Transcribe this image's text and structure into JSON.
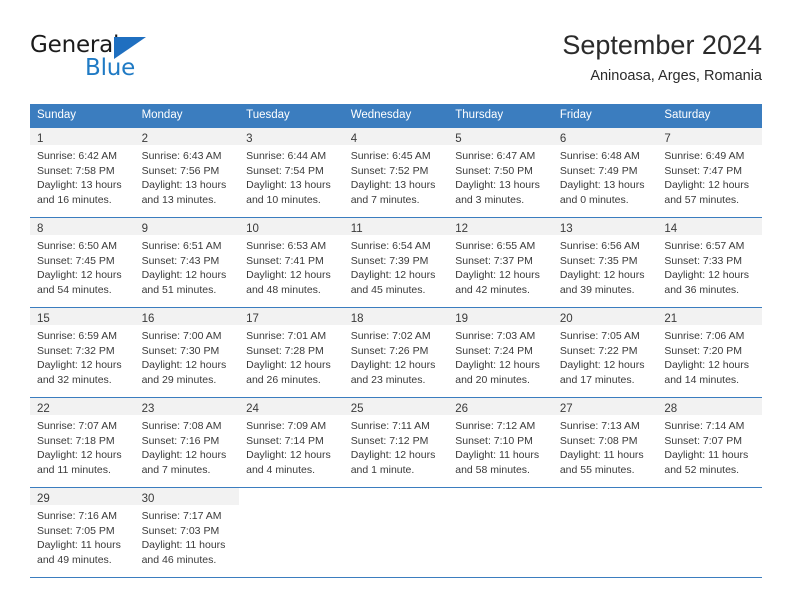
{
  "brand": {
    "name_top": "General",
    "name_bottom": "Blue",
    "accent_color": "#1f7ac4",
    "triangle_color": "#1f6fc0"
  },
  "header": {
    "title": "September 2024",
    "location": "Aninoasa, Arges, Romania"
  },
  "calendar": {
    "header_bg": "#3b7dbf",
    "daynum_band_bg": "#f2f2f2",
    "weekdays": [
      "Sunday",
      "Monday",
      "Tuesday",
      "Wednesday",
      "Thursday",
      "Friday",
      "Saturday"
    ],
    "weeks": [
      [
        {
          "day": "1",
          "sunrise": "Sunrise: 6:42 AM",
          "sunset": "Sunset: 7:58 PM",
          "daylight": "Daylight: 13 hours and 16 minutes."
        },
        {
          "day": "2",
          "sunrise": "Sunrise: 6:43 AM",
          "sunset": "Sunset: 7:56 PM",
          "daylight": "Daylight: 13 hours and 13 minutes."
        },
        {
          "day": "3",
          "sunrise": "Sunrise: 6:44 AM",
          "sunset": "Sunset: 7:54 PM",
          "daylight": "Daylight: 13 hours and 10 minutes."
        },
        {
          "day": "4",
          "sunrise": "Sunrise: 6:45 AM",
          "sunset": "Sunset: 7:52 PM",
          "daylight": "Daylight: 13 hours and 7 minutes."
        },
        {
          "day": "5",
          "sunrise": "Sunrise: 6:47 AM",
          "sunset": "Sunset: 7:50 PM",
          "daylight": "Daylight: 13 hours and 3 minutes."
        },
        {
          "day": "6",
          "sunrise": "Sunrise: 6:48 AM",
          "sunset": "Sunset: 7:49 PM",
          "daylight": "Daylight: 13 hours and 0 minutes."
        },
        {
          "day": "7",
          "sunrise": "Sunrise: 6:49 AM",
          "sunset": "Sunset: 7:47 PM",
          "daylight": "Daylight: 12 hours and 57 minutes."
        }
      ],
      [
        {
          "day": "8",
          "sunrise": "Sunrise: 6:50 AM",
          "sunset": "Sunset: 7:45 PM",
          "daylight": "Daylight: 12 hours and 54 minutes."
        },
        {
          "day": "9",
          "sunrise": "Sunrise: 6:51 AM",
          "sunset": "Sunset: 7:43 PM",
          "daylight": "Daylight: 12 hours and 51 minutes."
        },
        {
          "day": "10",
          "sunrise": "Sunrise: 6:53 AM",
          "sunset": "Sunset: 7:41 PM",
          "daylight": "Daylight: 12 hours and 48 minutes."
        },
        {
          "day": "11",
          "sunrise": "Sunrise: 6:54 AM",
          "sunset": "Sunset: 7:39 PM",
          "daylight": "Daylight: 12 hours and 45 minutes."
        },
        {
          "day": "12",
          "sunrise": "Sunrise: 6:55 AM",
          "sunset": "Sunset: 7:37 PM",
          "daylight": "Daylight: 12 hours and 42 minutes."
        },
        {
          "day": "13",
          "sunrise": "Sunrise: 6:56 AM",
          "sunset": "Sunset: 7:35 PM",
          "daylight": "Daylight: 12 hours and 39 minutes."
        },
        {
          "day": "14",
          "sunrise": "Sunrise: 6:57 AM",
          "sunset": "Sunset: 7:33 PM",
          "daylight": "Daylight: 12 hours and 36 minutes."
        }
      ],
      [
        {
          "day": "15",
          "sunrise": "Sunrise: 6:59 AM",
          "sunset": "Sunset: 7:32 PM",
          "daylight": "Daylight: 12 hours and 32 minutes."
        },
        {
          "day": "16",
          "sunrise": "Sunrise: 7:00 AM",
          "sunset": "Sunset: 7:30 PM",
          "daylight": "Daylight: 12 hours and 29 minutes."
        },
        {
          "day": "17",
          "sunrise": "Sunrise: 7:01 AM",
          "sunset": "Sunset: 7:28 PM",
          "daylight": "Daylight: 12 hours and 26 minutes."
        },
        {
          "day": "18",
          "sunrise": "Sunrise: 7:02 AM",
          "sunset": "Sunset: 7:26 PM",
          "daylight": "Daylight: 12 hours and 23 minutes."
        },
        {
          "day": "19",
          "sunrise": "Sunrise: 7:03 AM",
          "sunset": "Sunset: 7:24 PM",
          "daylight": "Daylight: 12 hours and 20 minutes."
        },
        {
          "day": "20",
          "sunrise": "Sunrise: 7:05 AM",
          "sunset": "Sunset: 7:22 PM",
          "daylight": "Daylight: 12 hours and 17 minutes."
        },
        {
          "day": "21",
          "sunrise": "Sunrise: 7:06 AM",
          "sunset": "Sunset: 7:20 PM",
          "daylight": "Daylight: 12 hours and 14 minutes."
        }
      ],
      [
        {
          "day": "22",
          "sunrise": "Sunrise: 7:07 AM",
          "sunset": "Sunset: 7:18 PM",
          "daylight": "Daylight: 12 hours and 11 minutes."
        },
        {
          "day": "23",
          "sunrise": "Sunrise: 7:08 AM",
          "sunset": "Sunset: 7:16 PM",
          "daylight": "Daylight: 12 hours and 7 minutes."
        },
        {
          "day": "24",
          "sunrise": "Sunrise: 7:09 AM",
          "sunset": "Sunset: 7:14 PM",
          "daylight": "Daylight: 12 hours and 4 minutes."
        },
        {
          "day": "25",
          "sunrise": "Sunrise: 7:11 AM",
          "sunset": "Sunset: 7:12 PM",
          "daylight": "Daylight: 12 hours and 1 minute."
        },
        {
          "day": "26",
          "sunrise": "Sunrise: 7:12 AM",
          "sunset": "Sunset: 7:10 PM",
          "daylight": "Daylight: 11 hours and 58 minutes."
        },
        {
          "day": "27",
          "sunrise": "Sunrise: 7:13 AM",
          "sunset": "Sunset: 7:08 PM",
          "daylight": "Daylight: 11 hours and 55 minutes."
        },
        {
          "day": "28",
          "sunrise": "Sunrise: 7:14 AM",
          "sunset": "Sunset: 7:07 PM",
          "daylight": "Daylight: 11 hours and 52 minutes."
        }
      ],
      [
        {
          "day": "29",
          "sunrise": "Sunrise: 7:16 AM",
          "sunset": "Sunset: 7:05 PM",
          "daylight": "Daylight: 11 hours and 49 minutes."
        },
        {
          "day": "30",
          "sunrise": "Sunrise: 7:17 AM",
          "sunset": "Sunset: 7:03 PM",
          "daylight": "Daylight: 11 hours and 46 minutes."
        },
        null,
        null,
        null,
        null,
        null
      ]
    ]
  }
}
